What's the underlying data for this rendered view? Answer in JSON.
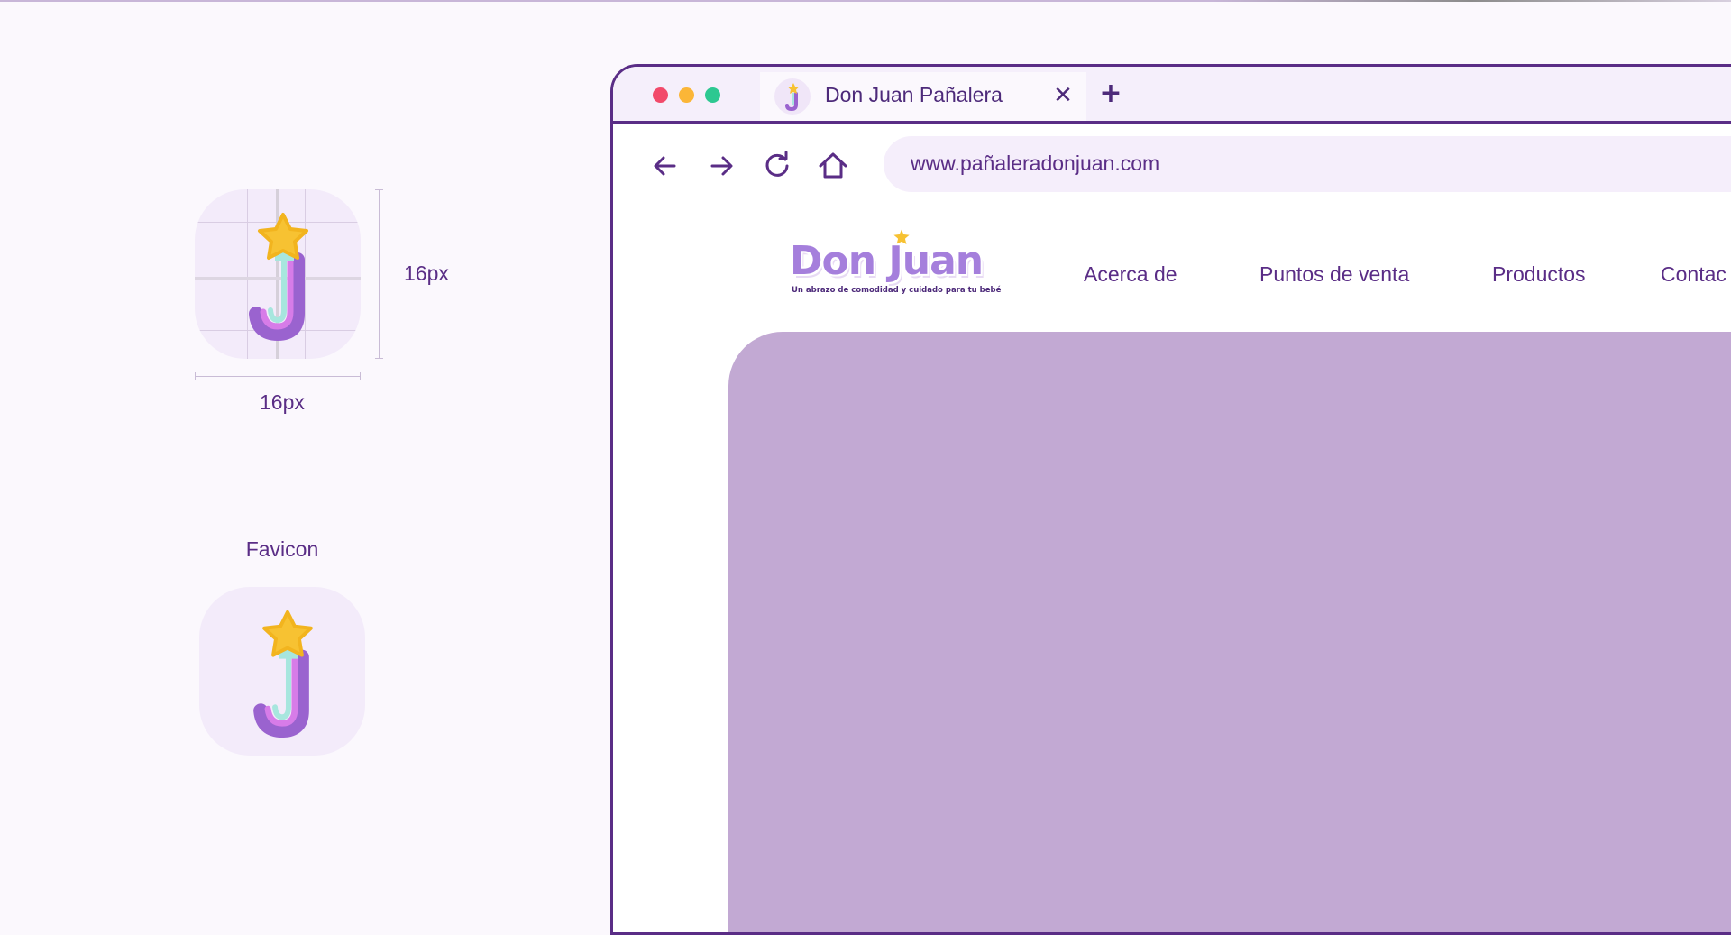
{
  "spec": {
    "height_label": "16px",
    "width_label": "16px",
    "favicon_title": "Favicon"
  },
  "browser": {
    "tab": {
      "title": "Don Juan Pañalera",
      "close_label": "✕"
    },
    "new_tab_label": "+",
    "url": "www.pañaleradonjuan.com"
  },
  "site": {
    "logo": {
      "name": "Don Juan",
      "tagline": "Un abrazo de comodidad y cuidado para tu bebé"
    },
    "nav": [
      {
        "label": "Acerca de"
      },
      {
        "label": "Puntos de venta"
      },
      {
        "label": "Productos"
      },
      {
        "label": "Contac"
      }
    ]
  },
  "icons": {
    "back": "arrow-left-icon",
    "forward": "arrow-right-icon",
    "reload": "reload-icon",
    "home": "home-icon",
    "favicon": "j-star-icon"
  },
  "colors": {
    "brand_purple": "#5a2d86",
    "logo_lilac": "#a57fdc",
    "hero_lilac": "#c2a9d3",
    "star_yellow": "#f7c232",
    "mint": "#a7e6de",
    "pink": "#d77ce8",
    "dot_red": "#f24a6a",
    "dot_yellow": "#fbb637",
    "dot_green": "#2dc891"
  }
}
